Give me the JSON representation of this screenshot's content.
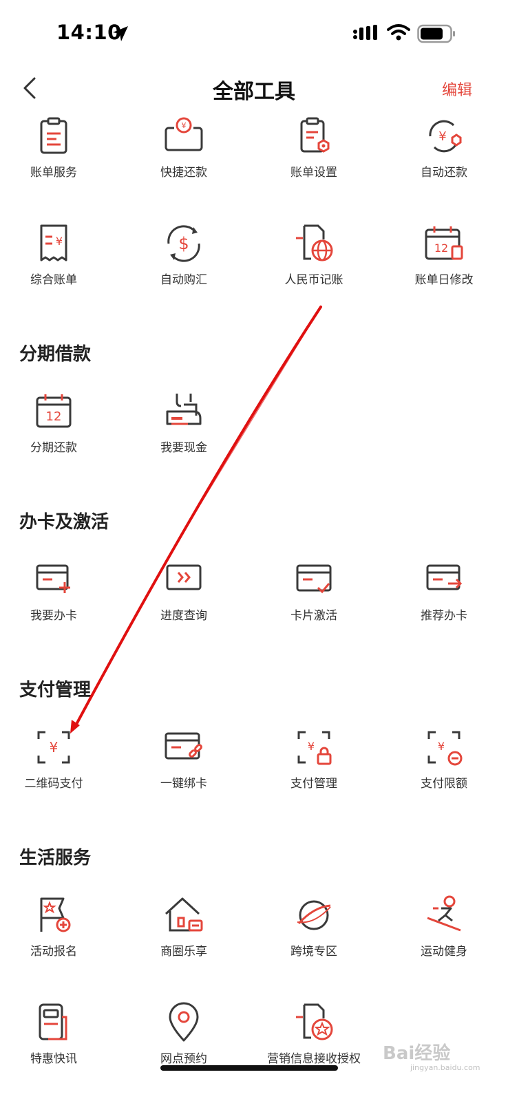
{
  "status_bar": {
    "time": "14:10"
  },
  "nav": {
    "title": "全部工具",
    "edit": "编辑"
  },
  "sections": {
    "installment": "分期借款",
    "card": "办卡及激活",
    "payment": "支付管理",
    "life": "生活服务"
  },
  "tools": {
    "bill_service": "账单服务",
    "quick_repay": "快捷还款",
    "bill_settings": "账单设置",
    "auto_repay": "自动还款",
    "combined_bill": "综合账单",
    "auto_fx": "自动购汇",
    "rmb_account": "人民币记账",
    "bill_date_change": "账单日修改",
    "installment_repay": "分期还款",
    "cash": "我要现金",
    "apply_card": "我要办卡",
    "progress_query": "进度查询",
    "card_activate": "卡片激活",
    "recommend_card": "推荐办卡",
    "qr_pay": "二维码支付",
    "bind_card": "一键绑卡",
    "pay_manage": "支付管理",
    "pay_limit": "支付限额",
    "event_signup": "活动报名",
    "shopping_district": "商圈乐享",
    "cross_border": "跨境专区",
    "sports": "运动健身",
    "deals_news": "特惠快讯",
    "branch_booking": "网点预约",
    "marketing_auth": "营销信息接收授权"
  },
  "watermark": {
    "text": "Bai经验",
    "sub": "jingyan.baidu.com"
  },
  "colors": {
    "accent": "#e4463b",
    "icon_dark": "#3a3a3a",
    "annotation_arrow": "#e01010"
  }
}
